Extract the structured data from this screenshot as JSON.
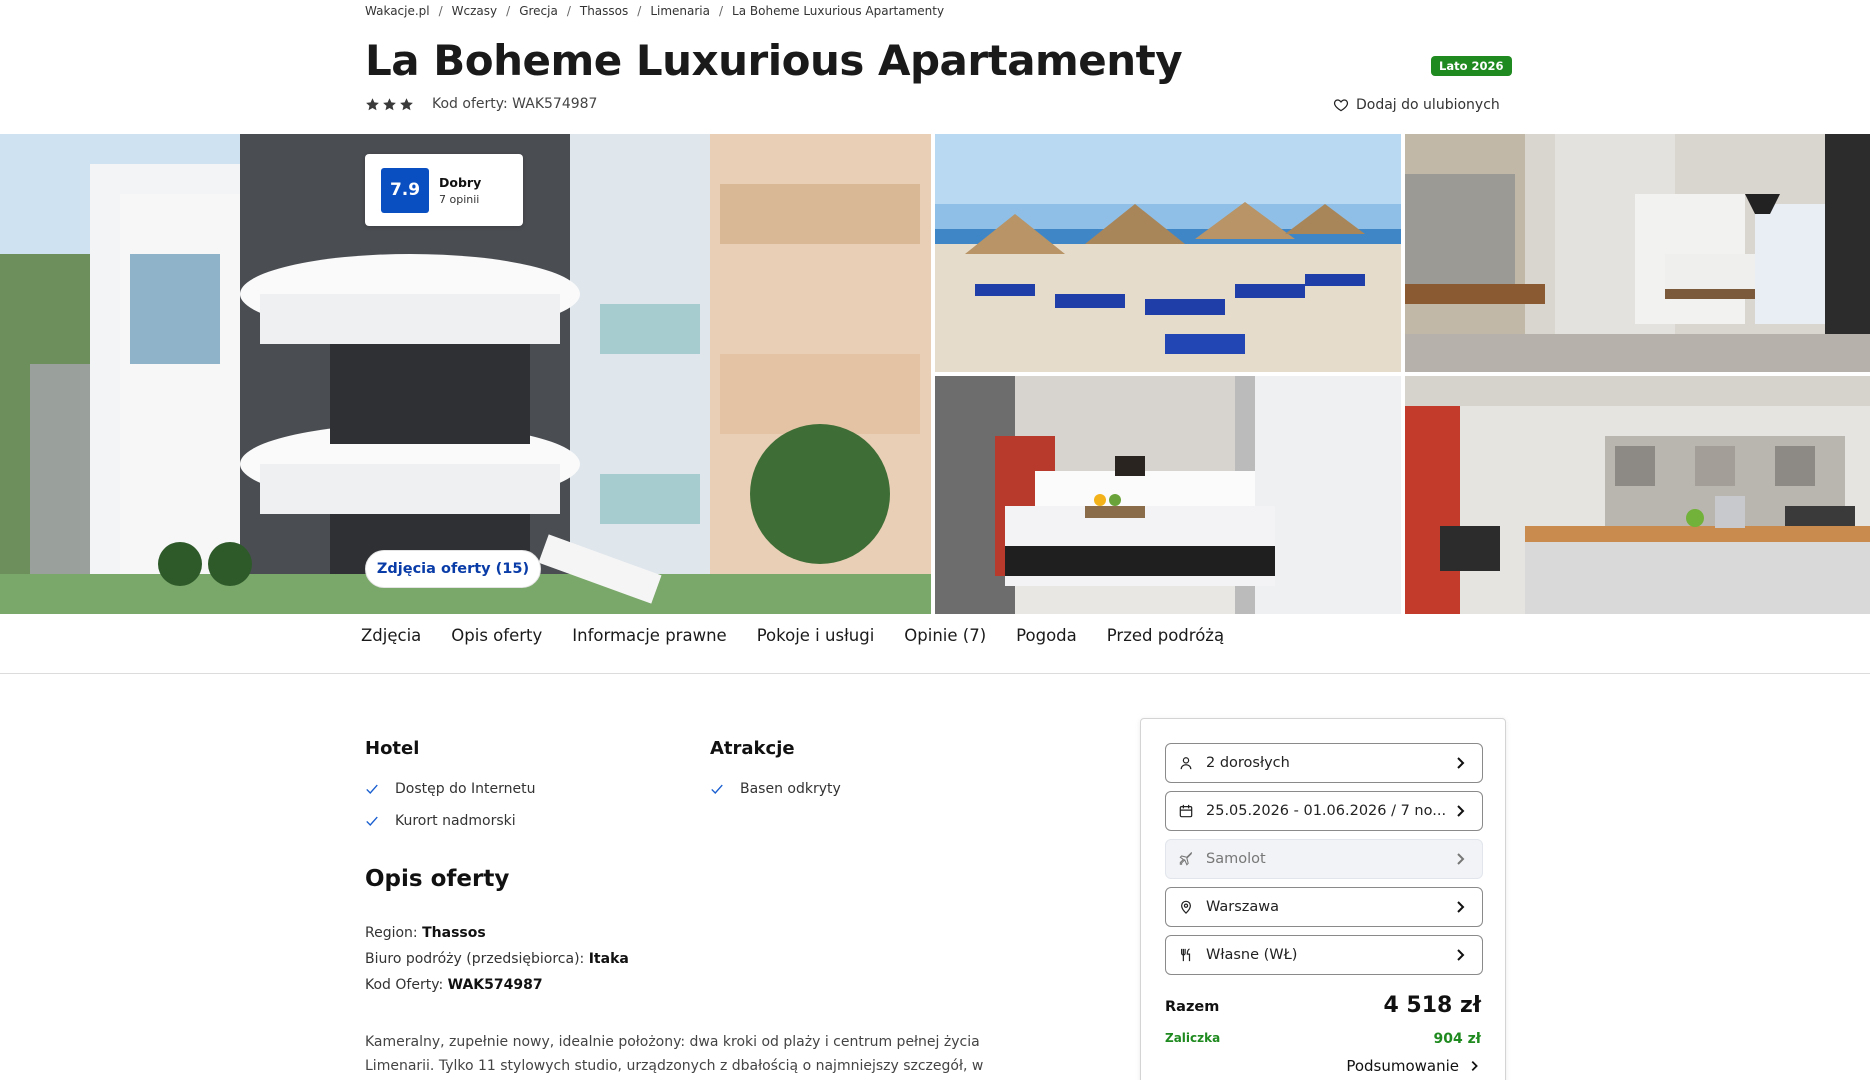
{
  "breadcrumb": [
    "Wakacje.pl",
    "Wczasy",
    "Grecja",
    "Thassos",
    "Limenaria",
    "La Boheme Luxurious Apartamenty"
  ],
  "title": "La Boheme Luxurious Apartamenty",
  "season_badge": "Lato 2026",
  "stars": 3,
  "offer_code": "Kod oferty: WAK574987",
  "favorite_label": "Dodaj do ulubionych",
  "rating": {
    "score": "7.9",
    "label": "Dobry",
    "count": "7 opinii"
  },
  "photos_button": "Zdjęcia oferty (15)",
  "tabs": [
    "Zdjęcia",
    "Opis oferty",
    "Informacje prawne",
    "Pokoje i usługi",
    "Opinie (7)",
    "Pogoda",
    "Przed podróżą"
  ],
  "hotel": {
    "heading": "Hotel",
    "features": [
      "Dostęp do Internetu",
      "Kurort nadmorski"
    ]
  },
  "attractions": {
    "heading": "Atrakcje",
    "features": [
      "Basen odkryty"
    ]
  },
  "description": {
    "heading": "Opis oferty",
    "region_label": "Region:",
    "region": "Thassos",
    "operator_label": "Biuro podróży (przedsiębiorca):",
    "operator": "Itaka",
    "code_label": "Kod Oferty:",
    "code": "WAK574987",
    "text": "Kameralny, zupełnie nowy, idealnie położony: dwa kroki od plaży i centrum pełnej życia Limenarii. Tylko 11 stylowych studio, urządzonych z dbałością o najmniejszy szczegół, w"
  },
  "booking": {
    "travelers": "2 dorosłych",
    "dates": "25.05.2026 - 01.06.2026 / 7 no...",
    "transport": "Samolot",
    "departure": "Warszawa",
    "board": "Własne (WŁ)",
    "total_label": "Razem",
    "total_price": "4 518 zł",
    "deposit_label": "Zaliczka",
    "deposit_price": "904 zł",
    "summary_label": "Podsumowanie"
  },
  "colors": {
    "brand_blue": "#0a4fc2",
    "green": "#1f8a1f",
    "text": "#1a1a1a"
  }
}
